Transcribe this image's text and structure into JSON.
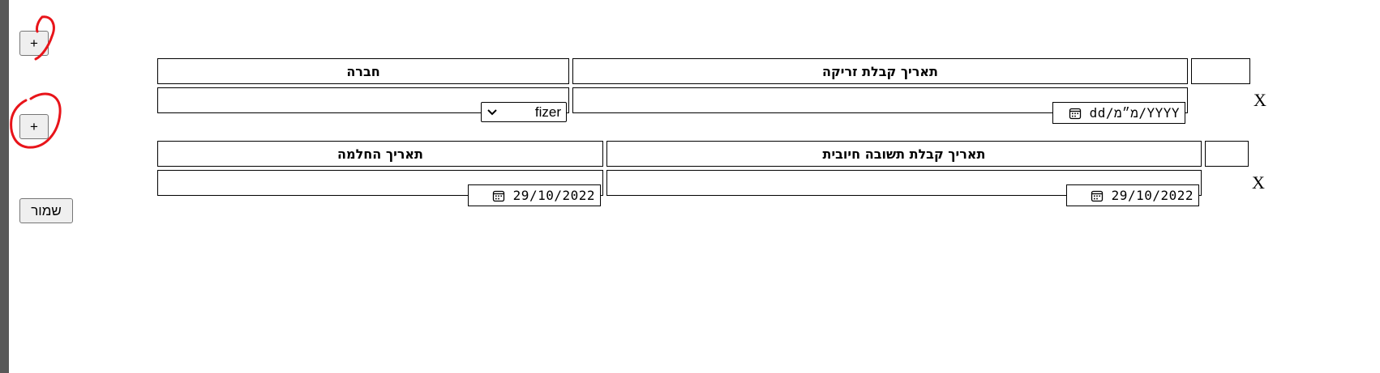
{
  "buttons": {
    "add_label": "+",
    "save_label": "שמור"
  },
  "section1": {
    "headers": {
      "company": "חברה",
      "injection_date": "תאריך קבלת זריקה"
    },
    "row": {
      "company_value": "fizer",
      "injection_date_value": "dd/מ״מ/YYYY",
      "remove_label": "X"
    }
  },
  "section2": {
    "headers": {
      "recovery_date": "תאריך החלמה",
      "positive_result_date": "תאריך קבלת תשובה חיובית"
    },
    "row": {
      "recovery_date_value": "29/10/2022",
      "positive_result_date_value": "29/10/2022",
      "remove_label": "X"
    }
  },
  "colors": {
    "annotation": "#e8141a",
    "button_bg": "#efefef",
    "left_strip": "#585858"
  },
  "icons": [
    "calendar-icon",
    "chevron-down-icon"
  ]
}
